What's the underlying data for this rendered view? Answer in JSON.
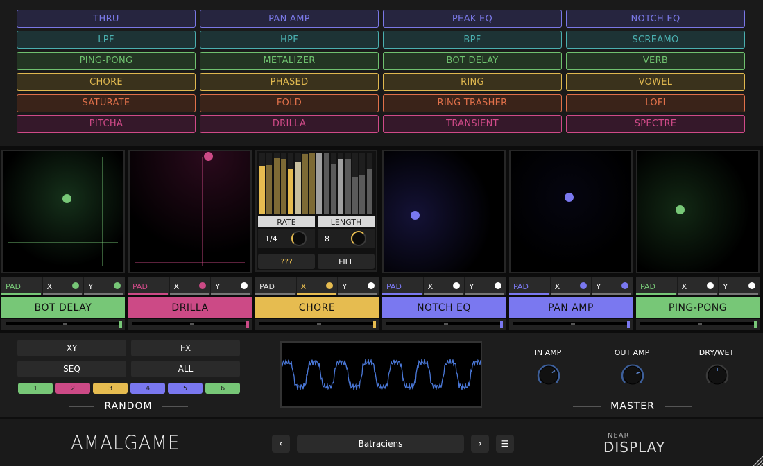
{
  "fx_buttons": [
    {
      "label": "THRU",
      "color": "#7a78e6",
      "bg": "#26253f"
    },
    {
      "label": "PAN AMP",
      "color": "#7a78e6",
      "bg": "#26253f"
    },
    {
      "label": "PEAK EQ",
      "color": "#7a78e6",
      "bg": "#26253f"
    },
    {
      "label": "NOTCH EQ",
      "color": "#7a78e6",
      "bg": "#26253f"
    },
    {
      "label": "LPF",
      "color": "#4bb0b0",
      "bg": "#1d3335"
    },
    {
      "label": "HPF",
      "color": "#4bb0b0",
      "bg": "#1d3335"
    },
    {
      "label": "BPF",
      "color": "#4bb0b0",
      "bg": "#1d3335"
    },
    {
      "label": "SCREAMO",
      "color": "#4bb0b0",
      "bg": "#1d3335"
    },
    {
      "label": "PING-PONG",
      "color": "#6fc16f",
      "bg": "#233523"
    },
    {
      "label": "METALIZER",
      "color": "#6fc16f",
      "bg": "#233523"
    },
    {
      "label": "BOT DELAY",
      "color": "#6fc16f",
      "bg": "#233523"
    },
    {
      "label": "VERB",
      "color": "#6fc16f",
      "bg": "#233523"
    },
    {
      "label": "CHORE",
      "color": "#e0b84f",
      "bg": "#3a321c"
    },
    {
      "label": "PHASED",
      "color": "#e0b84f",
      "bg": "#3a321c"
    },
    {
      "label": "RING",
      "color": "#e0b84f",
      "bg": "#3a321c"
    },
    {
      "label": "VOWEL",
      "color": "#e0b84f",
      "bg": "#3a321c"
    },
    {
      "label": "SATURATE",
      "color": "#e0704a",
      "bg": "#3a2319"
    },
    {
      "label": "FOLD",
      "color": "#e0704a",
      "bg": "#3a2319"
    },
    {
      "label": "RING TRASHER",
      "color": "#e0704a",
      "bg": "#3a2319"
    },
    {
      "label": "LOFI",
      "color": "#e0704a",
      "bg": "#3a2319"
    },
    {
      "label": "PITCHA",
      "color": "#d04a88",
      "bg": "#35182a"
    },
    {
      "label": "DRILLA",
      "color": "#d04a88",
      "bg": "#35182a"
    },
    {
      "label": "TRANSIENT",
      "color": "#d04a88",
      "bg": "#35182a"
    },
    {
      "label": "SPECTRE",
      "color": "#d04a88",
      "bg": "#35182a"
    }
  ],
  "slots": [
    {
      "name": "BOT DELAY",
      "color": "#77c777",
      "mode": "pad",
      "pad_label": "PAD",
      "x_label": "X",
      "y_label": "Y",
      "x_dot": "#77c777",
      "y_dot": "#77c777",
      "point": [
        0.53,
        0.39
      ],
      "cross": [
        0.24,
        0.75
      ],
      "glow": "#15301a"
    },
    {
      "name": "DRILLA",
      "color": "#cc4a86",
      "mode": "pad",
      "pad_label": "PAD",
      "x_label": "X",
      "y_label": "Y",
      "x_dot": "#cc4a86",
      "y_dot": "#ffffff",
      "point": [
        0.65,
        0.04
      ],
      "cross": [
        0.14,
        0.92
      ],
      "glow": "#2a0a1c"
    },
    {
      "name": "CHORE",
      "color": "#e6bc50",
      "mode": "seq",
      "pad_label": "PAD",
      "x_label": "X",
      "y_label": "Y",
      "x_dot": "#e6bc50",
      "y_dot": "#ffffff"
    },
    {
      "name": "NOTCH EQ",
      "color": "#7a78f0",
      "mode": "pad",
      "pad_label": "PAD",
      "x_label": "X",
      "y_label": "Y",
      "x_dot": "#ffffff",
      "y_dot": "#ffffff",
      "point": [
        0.26,
        0.53
      ],
      "glow": "#141236"
    },
    {
      "name": "PAN AMP",
      "color": "#7a78f0",
      "mode": "pad",
      "pad_label": "PAD",
      "x_label": "X",
      "y_label": "Y",
      "x_dot": "#7a78f0",
      "y_dot": "#7a78f0",
      "point": [
        0.48,
        0.38
      ],
      "glow": "#050510"
    },
    {
      "name": "PING-PONG",
      "color": "#77c777",
      "mode": "pad",
      "pad_label": "PAD",
      "x_label": "X",
      "y_label": "Y",
      "x_dot": "#ffffff",
      "y_dot": "#ffffff",
      "point": [
        0.35,
        0.48
      ],
      "glow": "#122814"
    }
  ],
  "sequencer": {
    "steps": [
      0.77,
      0.8,
      0.91,
      0.89,
      0.74,
      0.85,
      0.98,
      0.99,
      0.99,
      0.99,
      0.81,
      0.89,
      0.89,
      0.6,
      0.63,
      0.73
    ],
    "highlight_color": "#e6bc50",
    "rate_label": "RATE",
    "rate_value": "1/4",
    "length_label": "LENGTH",
    "length_value": "8",
    "random_label": "???",
    "fill_label": "FILL"
  },
  "random": {
    "title": "RANDOM",
    "xy": "XY",
    "fx": "FX",
    "seq": "SEQ",
    "all": "ALL",
    "slots": [
      {
        "label": "1",
        "color": "#77c777"
      },
      {
        "label": "2",
        "color": "#cc4a86"
      },
      {
        "label": "3",
        "color": "#e6bc50"
      },
      {
        "label": "4",
        "color": "#7a78f0"
      },
      {
        "label": "5",
        "color": "#7a78f0"
      },
      {
        "label": "6",
        "color": "#77c777"
      }
    ]
  },
  "master": {
    "title": "MASTER",
    "knobs": [
      {
        "label": "IN AMP",
        "value": 0.7,
        "active": true
      },
      {
        "label": "OUT AMP",
        "value": 0.75,
        "active": true
      },
      {
        "label": "DRY/WET",
        "value": 0.5,
        "active": false
      }
    ]
  },
  "footer": {
    "logo": "AMALGAME",
    "preset": "Batraciens",
    "prev": "‹",
    "next": "›",
    "menu": "☰",
    "brand_top": "INEAR",
    "brand_bottom": "DISPLAY"
  }
}
